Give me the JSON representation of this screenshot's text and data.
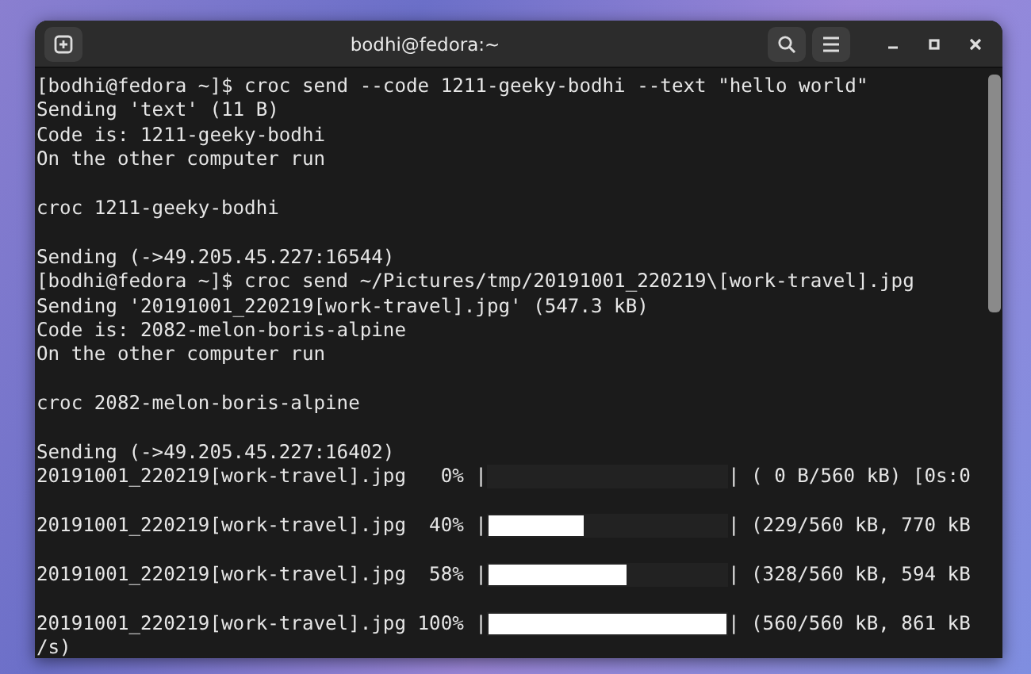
{
  "window": {
    "title": "bodhi@fedora:~"
  },
  "terminal": {
    "lines": [
      {
        "kind": "text",
        "text": "[bodhi@fedora ~]$ croc send --code 1211-geeky-bodhi --text \"hello world\""
      },
      {
        "kind": "text",
        "text": "Sending 'text' (11 B)"
      },
      {
        "kind": "text",
        "text": "Code is: 1211-geeky-bodhi"
      },
      {
        "kind": "text",
        "text": "On the other computer run"
      },
      {
        "kind": "blank"
      },
      {
        "kind": "text",
        "text": "croc 1211-geeky-bodhi"
      },
      {
        "kind": "blank"
      },
      {
        "kind": "text",
        "text": "Sending (->49.205.45.227:16544)"
      },
      {
        "kind": "text",
        "text": "[bodhi@fedora ~]$ croc send ~/Pictures/tmp/20191001_220219\\[work-travel].jpg"
      },
      {
        "kind": "text",
        "text": "Sending '20191001_220219[work-travel].jpg' (547.3 kB)"
      },
      {
        "kind": "text",
        "text": "Code is: 2082-melon-boris-alpine"
      },
      {
        "kind": "text",
        "text": "On the other computer run"
      },
      {
        "kind": "blank"
      },
      {
        "kind": "text",
        "text": "croc 2082-melon-boris-alpine"
      },
      {
        "kind": "blank"
      },
      {
        "kind": "text",
        "text": "Sending (->49.205.45.227:16402)"
      },
      {
        "kind": "progress",
        "prefix": "20191001_220219[work-travel].jpg   0% |",
        "level": 0,
        "suffix": "| ( 0 B/560 kB) [0s:0"
      },
      {
        "kind": "blank"
      },
      {
        "kind": "progress",
        "prefix": "20191001_220219[work-travel].jpg  40% |",
        "level": 0.4,
        "suffix": "| (229/560 kB, 770 kB"
      },
      {
        "kind": "blank"
      },
      {
        "kind": "progress",
        "prefix": "20191001_220219[work-travel].jpg  58% |",
        "level": 0.58,
        "suffix": "| (328/560 kB, 594 kB"
      },
      {
        "kind": "blank"
      },
      {
        "kind": "progress",
        "prefix": "20191001_220219[work-travel].jpg 100% |",
        "level": 1,
        "suffix": "| (560/560 kB, 861 kB"
      },
      {
        "kind": "text",
        "text": "/s)"
      }
    ]
  }
}
